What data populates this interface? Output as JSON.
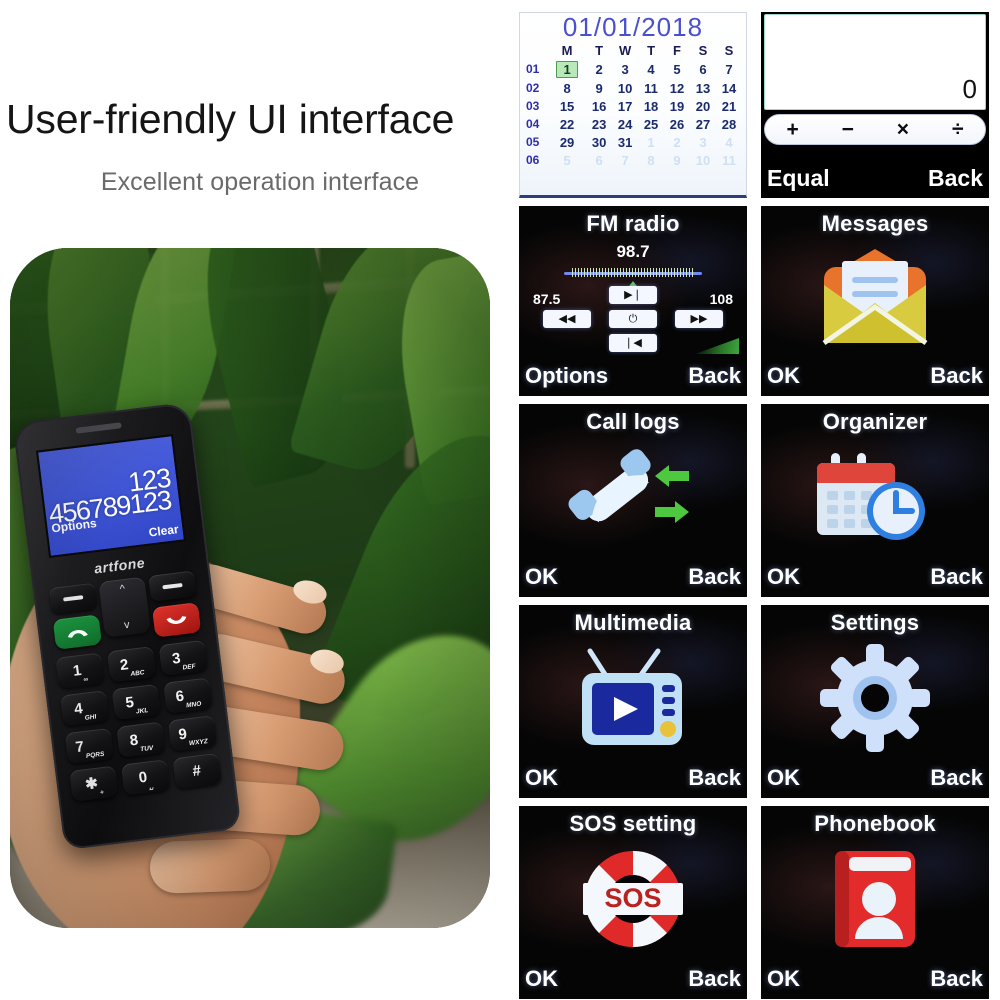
{
  "marketing": {
    "headline": "User-friendly UI interface",
    "subheadline": "Excellent operation interface"
  },
  "photo": {
    "alt": "hand-holding-artfone-senior-phone",
    "phone_brand": "artfone",
    "screen": {
      "line1": "123",
      "line2": "456789123",
      "softkey_left": "Options",
      "softkey_right": "Clear"
    },
    "keys": [
      {
        "digit": "1",
        "letters": "∞"
      },
      {
        "digit": "2",
        "letters": "ABC"
      },
      {
        "digit": "3",
        "letters": "DEF"
      },
      {
        "digit": "4",
        "letters": "GHI"
      },
      {
        "digit": "5",
        "letters": "JKL"
      },
      {
        "digit": "6",
        "letters": "MNO"
      },
      {
        "digit": "7",
        "letters": "PQRS"
      },
      {
        "digit": "8",
        "letters": "TUV"
      },
      {
        "digit": "9",
        "letters": "WXYZ"
      },
      {
        "digit": "✱",
        "letters": "+"
      },
      {
        "digit": "0",
        "letters": "␣"
      },
      {
        "digit": "#",
        "letters": ""
      }
    ]
  },
  "panels": {
    "calendar": {
      "title": "01/01/2018",
      "weekday_headers": [
        "M",
        "T",
        "W",
        "T",
        "F",
        "S",
        "S"
      ],
      "week_numbers": [
        "01",
        "02",
        "03",
        "04",
        "05",
        "06"
      ],
      "weeks": [
        [
          "1",
          "2",
          "3",
          "4",
          "5",
          "6",
          "7"
        ],
        [
          "8",
          "9",
          "10",
          "11",
          "12",
          "13",
          "14"
        ],
        [
          "15",
          "16",
          "17",
          "18",
          "19",
          "20",
          "21"
        ],
        [
          "22",
          "23",
          "24",
          "25",
          "26",
          "27",
          "28"
        ],
        [
          "29",
          "30",
          "31",
          "1",
          "2",
          "3",
          "4"
        ],
        [
          "5",
          "6",
          "7",
          "8",
          "9",
          "10",
          "11"
        ]
      ],
      "selected_day": "1",
      "selection_color": "#b9e8b9",
      "title_color": "#4a4fd0"
    },
    "calculator": {
      "display_value": "0",
      "operators": [
        "+",
        "−",
        "×",
        "÷"
      ],
      "softkey_left": "Equal",
      "softkey_right": "Back"
    },
    "fm_radio": {
      "title": "FM radio",
      "frequency": "98.7",
      "range_min": "87.5",
      "range_max": "108",
      "buttons": [
        "▶❘",
        "◀◀",
        "⏻",
        "▶▶",
        "❘◀"
      ],
      "softkey_left": "Options",
      "softkey_right": "Back"
    },
    "messages": {
      "title": "Messages",
      "icon": "envelope-icon",
      "softkey_left": "OK",
      "softkey_right": "Back",
      "icon_colors": {
        "flap": "#e8732d",
        "body": "#d9cb3f",
        "letter": "#e8f1fb"
      }
    },
    "call_logs": {
      "title": "Call logs",
      "icon": "handset-with-arrows-icon",
      "softkey_left": "OK",
      "softkey_right": "Back",
      "icon_colors": {
        "handset": "#e8f4ff",
        "accent": "#9cc7ef",
        "arrows": "#4ec93f"
      }
    },
    "organizer": {
      "title": "Organizer",
      "icon": "calendar-clock-icon",
      "softkey_left": "OK",
      "softkey_right": "Back",
      "icon_colors": {
        "header": "#e0453c",
        "body": "#dce9f5",
        "clock": "#2f7fe0"
      }
    },
    "multimedia": {
      "title": "Multimedia",
      "icon": "television-play-icon",
      "softkey_left": "OK",
      "softkey_right": "Back",
      "icon_colors": {
        "case": "#bfe0f5",
        "screen": "#1a2a9e",
        "play": "#ffffff",
        "knob": "#e8c23a"
      }
    },
    "settings": {
      "title": "Settings",
      "icon": "gear-icon",
      "softkey_left": "OK",
      "softkey_right": "Back",
      "icon_colors": {
        "gear": "#cfe0fb",
        "ring": "#9fc2ef"
      }
    },
    "sos_setting": {
      "title": "SOS setting",
      "icon": "lifebuoy-sos-icon",
      "label": "SOS",
      "softkey_left": "OK",
      "softkey_right": "Back",
      "icon_colors": {
        "red": "#e02a2a",
        "white": "#f4f7fb",
        "text": "#b8231f"
      }
    },
    "phonebook": {
      "title": "Phonebook",
      "icon": "contacts-book-icon",
      "softkey_left": "OK",
      "softkey_right": "Back",
      "icon_colors": {
        "book": "#e32b2b",
        "page": "#f0f2f5",
        "person": "#eaf2fa"
      }
    }
  }
}
